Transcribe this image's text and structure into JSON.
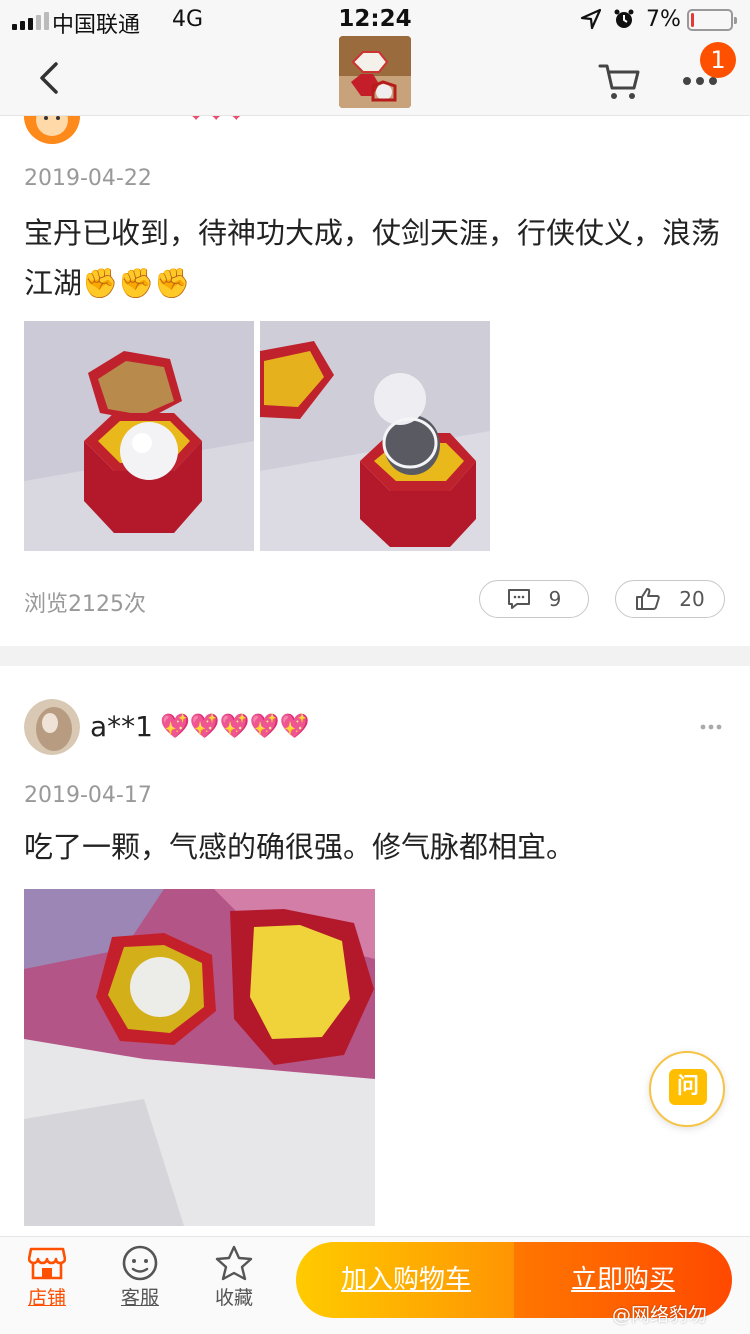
{
  "status_bar": {
    "carrier": "中国联通",
    "network": "4G",
    "time": "12:24",
    "battery_percent": "7%",
    "battery_level": 0.07
  },
  "nav": {
    "cart_badge": "1"
  },
  "reviews": [
    {
      "user": "",
      "date": "2019-04-22",
      "text": "宝丹已收到，待神功大成，仗剑天涯，行侠仗义，浪荡江湖✊✊✊",
      "views": "浏览2125次",
      "comments": "9",
      "likes": "20"
    },
    {
      "user": "a**1",
      "hearts": 5,
      "date": "2019-04-17",
      "text": "吃了一颗，气感的确很强。修气脉都相宜。"
    }
  ],
  "ask_button": "问",
  "bottom_bar": {
    "tabs": [
      {
        "label": "店铺",
        "icon": "store-icon"
      },
      {
        "label": "客服",
        "icon": "customer-service-icon"
      },
      {
        "label": "收藏",
        "icon": "star-icon"
      }
    ],
    "add_to_cart": "加入购物车",
    "buy_now": "立即购买"
  },
  "watermark": "@网络豹勿"
}
